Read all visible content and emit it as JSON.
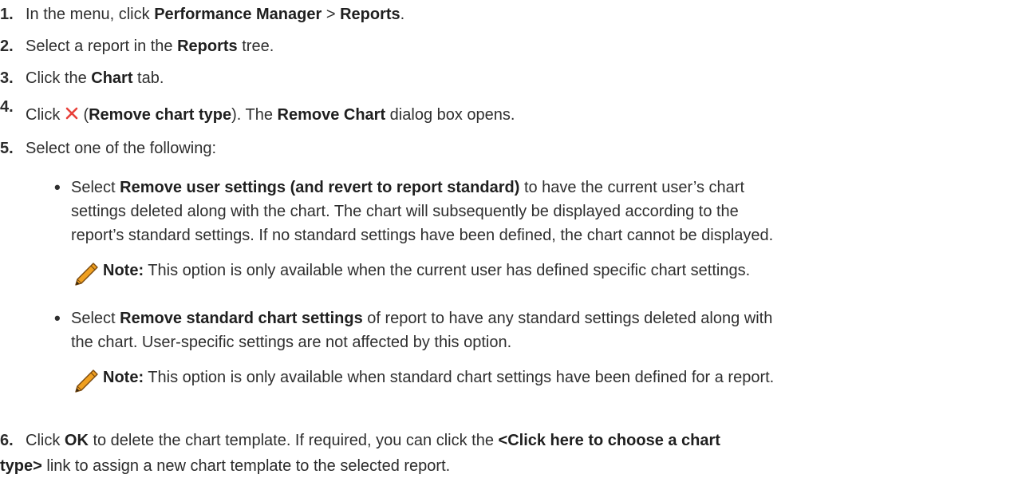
{
  "steps": [
    {
      "num": "1.",
      "pre": "In the menu, click ",
      "b1": "Performance Manager",
      "mid": " > ",
      "b2": "Reports",
      "post": "."
    },
    {
      "num": "2.",
      "pre": "Select a report in the ",
      "b1": "Reports",
      "post": " tree."
    },
    {
      "num": "3.",
      "pre": "Click the ",
      "b1": "Chart",
      "post": " tab."
    },
    {
      "num": "4.",
      "pre": "Click ",
      "icon": "remove-x-icon",
      "paren_open": " (",
      "b1": "Remove chart type",
      "mid": "). The ",
      "b2": "Remove Chart",
      "post": " dialog box opens."
    },
    {
      "num": "5.",
      "pre": "Select one of the following:"
    },
    {
      "num": "6.",
      "pre": "Click ",
      "b1": "OK",
      "mid": " to delete the chart template. If required, you can click the ",
      "b2": "<Click here to choose a chart",
      "line2_b": "type>",
      "line2_post": " link to assign a new chart template to the selected report."
    }
  ],
  "bullets": [
    {
      "pre": "Select ",
      "b": "Remove user settings (and revert to report standard)",
      "post": " to have the current user’s chart",
      "line2": "settings deleted along with the chart. The chart will subsequently be displayed according to the",
      "line3": "report’s standard settings. If no standard settings have been defined, the chart cannot be displayed.",
      "note_label": "Note:",
      "note_text": " This option is only available when the current user has defined specific chart settings."
    },
    {
      "pre": "Select ",
      "b": "Remove standard chart settings",
      "post": " of report to have any standard settings deleted along with",
      "line2": "the chart. User-specific settings are not affected by this option.",
      "note_label": "Note:",
      "note_text": " This option is only available when standard chart settings have been defined for a report."
    }
  ],
  "colors": {
    "remove_icon": "#e8403a",
    "pencil_body": "#f0a020",
    "pencil_outline": "#7a4a10"
  },
  "icons": {
    "note": "pencil-icon",
    "remove": "remove-x-icon"
  }
}
